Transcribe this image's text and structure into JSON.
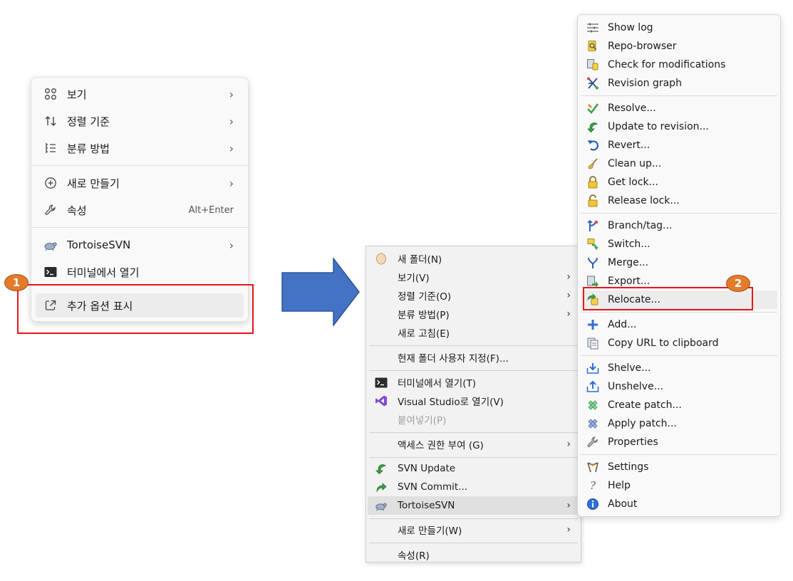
{
  "menu_main": {
    "items": [
      {
        "label": "보기",
        "icon": "view-grid-icon",
        "submenu": true
      },
      {
        "label": "정렬 기준",
        "icon": "sort-icon",
        "submenu": true
      },
      {
        "label": "분류 방법",
        "icon": "group-list-icon",
        "submenu": true
      },
      {
        "label": "새로 만들기",
        "icon": "plus-circle-icon",
        "submenu": true
      },
      {
        "label": "속성",
        "icon": "wrench-icon",
        "shortcut": "Alt+Enter"
      },
      {
        "label": "TortoiseSVN",
        "icon": "tortoise-icon",
        "submenu": true
      },
      {
        "label": "터미널에서 열기",
        "icon": "terminal-icon"
      },
      {
        "label": "추가 옵션 표시",
        "icon": "show-more-icon"
      }
    ]
  },
  "menu_classic": {
    "items": [
      {
        "label": "새 폴더(N)",
        "icon": "new-folder-icon"
      },
      {
        "label": "보기(V)",
        "submenu": true
      },
      {
        "label": "정렬 기준(O)",
        "submenu": true
      },
      {
        "label": "분류 방법(P)",
        "submenu": true
      },
      {
        "label": "새로 고침(E)"
      },
      {
        "label": "현재 폴더 사용자 지정(F)..."
      },
      {
        "label": "터미널에서 열기(T)",
        "icon": "terminal-icon"
      },
      {
        "label": "Visual Studio로 열기(V)",
        "icon": "visual-studio-icon"
      },
      {
        "label": "붙여넣기(P)",
        "disabled": true
      },
      {
        "label": "액세스 권한 부여 (G)",
        "submenu": true
      },
      {
        "label": "SVN Update",
        "icon": "svn-update-icon"
      },
      {
        "label": "SVN Commit...",
        "icon": "svn-commit-icon"
      },
      {
        "label": "TortoiseSVN",
        "icon": "tortoise-icon",
        "submenu": true
      },
      {
        "label": "새로 만들기(W)",
        "submenu": true
      },
      {
        "label": "속성(R)"
      }
    ]
  },
  "menu_svn": {
    "items": [
      {
        "label": "Show log",
        "icon": "show-log-icon"
      },
      {
        "label": "Repo-browser",
        "icon": "repo-browser-icon"
      },
      {
        "label": "Check for modifications",
        "icon": "check-modifications-icon"
      },
      {
        "label": "Revision graph",
        "icon": "revision-graph-icon"
      },
      {
        "label": "Resolve...",
        "icon": "resolve-icon"
      },
      {
        "label": "Update to revision...",
        "icon": "update-revision-icon"
      },
      {
        "label": "Revert...",
        "icon": "revert-icon"
      },
      {
        "label": "Clean up...",
        "icon": "cleanup-icon"
      },
      {
        "label": "Get lock...",
        "icon": "lock-icon"
      },
      {
        "label": "Release lock...",
        "icon": "unlock-icon"
      },
      {
        "label": "Branch/tag...",
        "icon": "branch-icon"
      },
      {
        "label": "Switch...",
        "icon": "switch-icon"
      },
      {
        "label": "Merge...",
        "icon": "merge-icon"
      },
      {
        "label": "Export...",
        "icon": "export-icon"
      },
      {
        "label": "Relocate...",
        "icon": "relocate-icon"
      },
      {
        "label": "Add...",
        "icon": "add-icon"
      },
      {
        "label": "Copy URL to clipboard",
        "icon": "copy-url-icon"
      },
      {
        "label": "Shelve...",
        "icon": "shelve-icon"
      },
      {
        "label": "Unshelve...",
        "icon": "unshelve-icon"
      },
      {
        "label": "Create patch...",
        "icon": "create-patch-icon"
      },
      {
        "label": "Apply patch...",
        "icon": "apply-patch-icon"
      },
      {
        "label": "Properties",
        "icon": "properties-icon"
      },
      {
        "label": "Settings",
        "icon": "settings-icon"
      },
      {
        "label": "Help",
        "icon": "help-icon"
      },
      {
        "label": "About",
        "icon": "about-icon"
      }
    ]
  },
  "annotations": {
    "step1": "1",
    "step2": "2",
    "marker_color": "#e8141c",
    "badge_color": "#e37b2a",
    "arrow_color": "#4472c4"
  }
}
